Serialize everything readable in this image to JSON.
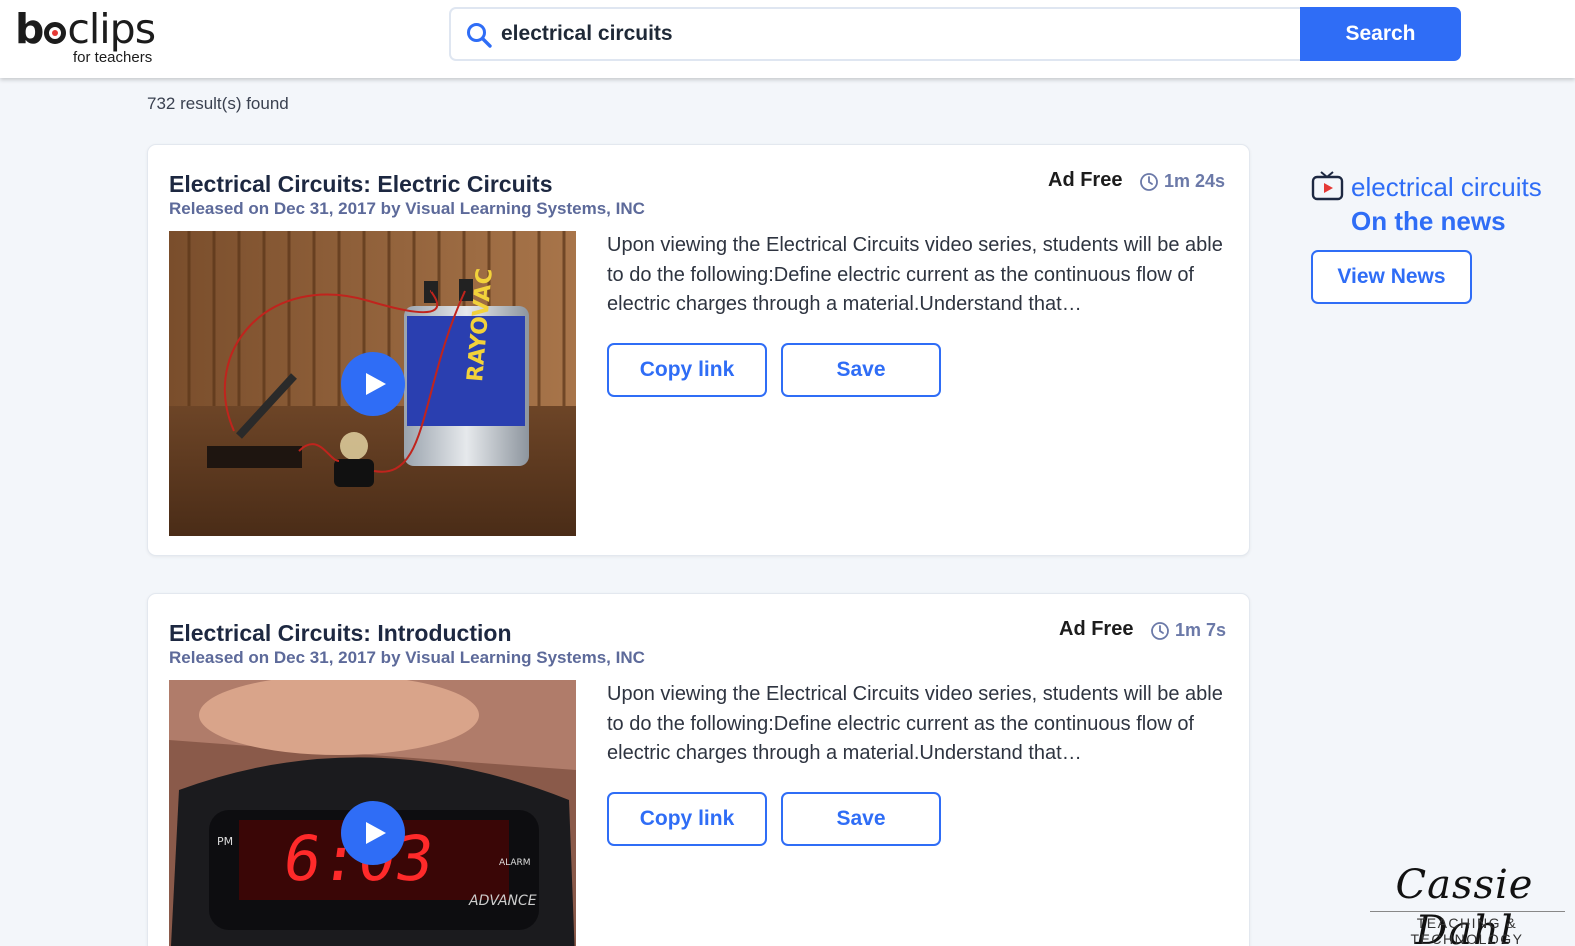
{
  "header": {
    "logo_word": "boclips",
    "logo_sub": "for teachers",
    "search_value": "electrical circuits",
    "search_button": "Search"
  },
  "results_count": "732 result(s) found",
  "results": [
    {
      "title": "Electrical Circuits: Electric Circuits",
      "meta": "Released on Dec 31, 2017 by Visual Learning Systems, INC",
      "ad_label": "Ad Free",
      "duration": "1m 24s",
      "description": "Upon viewing the Electrical Circuits video series, students will be able to do the following:Define electric current as the continuous flow of electric charges through a material.Understand that…",
      "copy_label": "Copy link",
      "save_label": "Save"
    },
    {
      "title": "Electrical Circuits: Introduction",
      "meta": "Released on Dec 31, 2017 by Visual Learning Systems, INC",
      "ad_label": "Ad Free",
      "duration": "1m 7s",
      "description": "Upon viewing the Electrical Circuits video series, students will be able to do the following:Define electric current as the continuous flow of electric charges through a material.Understand that…",
      "copy_label": "Copy link",
      "save_label": "Save"
    }
  ],
  "news": {
    "topic": "electrical circuits",
    "subtitle": "On the news",
    "button": "View News"
  },
  "watermark": {
    "signature": "Cassie Dahl",
    "tagline": "TEACHING & TECHNOLOGY"
  },
  "colors": {
    "accent": "#2f6df6",
    "meta": "#5d6a9a",
    "background": "#f3f6fa"
  }
}
